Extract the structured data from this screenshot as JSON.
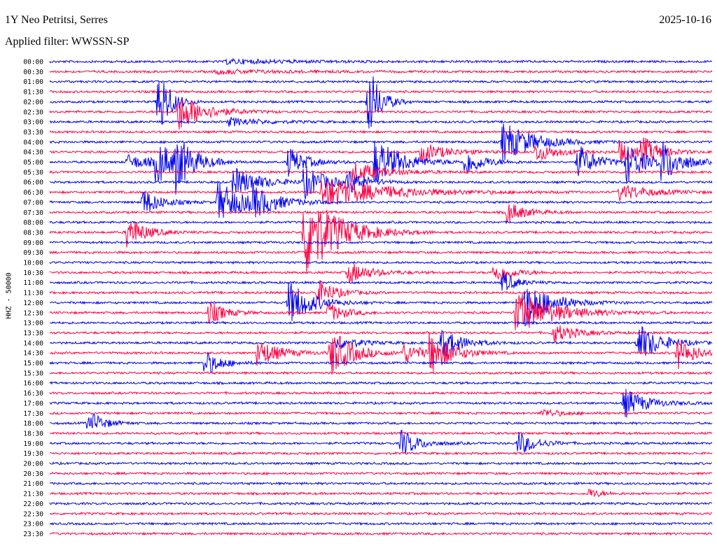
{
  "header": {
    "station": "1Y Neo Petritsi, Serres",
    "date": "2025-10-16",
    "filter": "Applied filter: WWSSN-SP"
  },
  "colors": {
    "even_trace": "#0000ee",
    "odd_trace": "#ff0044",
    "text": "#000000"
  },
  "chart_data": {
    "type": "line",
    "title": "1Y Neo Petritsi, Serres",
    "ylabel": "HHZ - 50000",
    "rows": [
      "00:00",
      "00:30",
      "01:00",
      "01:30",
      "02:00",
      "02:30",
      "03:00",
      "03:30",
      "04:00",
      "04:30",
      "05:00",
      "05:30",
      "06:00",
      "06:30",
      "07:00",
      "07:30",
      "08:00",
      "08:30",
      "09:00",
      "09:30",
      "10:00",
      "10:30",
      "11:00",
      "11:30",
      "12:00",
      "12:30",
      "13:00",
      "13:30",
      "14:00",
      "14:30",
      "15:00",
      "15:30",
      "16:00",
      "16:30",
      "17:00",
      "17:30",
      "18:00",
      "18:30",
      "19:00",
      "19:30",
      "20:00",
      "20:30",
      "21:00",
      "21:30",
      "22:00",
      "22:30",
      "23:00",
      "23:30"
    ],
    "minutes_per_row": 30,
    "events": [
      {
        "row": 4,
        "minute": 4.9,
        "amp": 60,
        "dur": 0.5
      },
      {
        "row": 5,
        "minute": 5.8,
        "amp": 28,
        "dur": 1.2
      },
      {
        "row": 4,
        "minute": 14.4,
        "amp": 60,
        "dur": 0.5
      },
      {
        "row": 8,
        "minute": 20.5,
        "amp": 30,
        "dur": 1.4
      },
      {
        "row": 13,
        "minute": 12.3,
        "amp": 22,
        "dur": 3.0
      },
      {
        "row": 10,
        "minute": 4.8,
        "amp": 32,
        "dur": 0.8
      },
      {
        "row": 10,
        "minute": 5.7,
        "amp": 34,
        "dur": 0.8
      },
      {
        "row": 10,
        "minute": 10.8,
        "amp": 22,
        "dur": 0.8
      },
      {
        "row": 10,
        "minute": 14.7,
        "amp": 36,
        "dur": 1.2
      },
      {
        "row": 10,
        "minute": 18.8,
        "amp": 20,
        "dur": 0.8
      },
      {
        "row": 10,
        "minute": 23.9,
        "amp": 26,
        "dur": 0.8
      },
      {
        "row": 10,
        "minute": 26.1,
        "amp": 30,
        "dur": 0.8
      },
      {
        "row": 10,
        "minute": 27.7,
        "amp": 30,
        "dur": 0.9
      },
      {
        "row": 9,
        "minute": 16.8,
        "amp": 14,
        "dur": 1.2
      },
      {
        "row": 9,
        "minute": 22.0,
        "amp": 14,
        "dur": 1.0
      },
      {
        "row": 9,
        "minute": 25.8,
        "amp": 16,
        "dur": 0.8
      },
      {
        "row": 9,
        "minute": 26.8,
        "amp": 20,
        "dur": 0.8
      },
      {
        "row": 8,
        "minute": 32.0,
        "amp": 22,
        "dur": 0.6
      },
      {
        "row": 10,
        "minute": 3.5,
        "amp": 10,
        "dur": 1.5
      },
      {
        "row": 12,
        "minute": 8.3,
        "amp": 22,
        "dur": 1.2
      },
      {
        "row": 12,
        "minute": 13.5,
        "amp": 16,
        "dur": 0.8
      },
      {
        "row": 11,
        "minute": 13.7,
        "amp": 14,
        "dur": 1.5
      },
      {
        "row": 14,
        "minute": 4.2,
        "amp": 20,
        "dur": 0.8
      },
      {
        "row": 14,
        "minute": 7.6,
        "amp": 30,
        "dur": 1.3
      },
      {
        "row": 14,
        "minute": 9.1,
        "amp": 20,
        "dur": 1.0
      },
      {
        "row": 15,
        "minute": 20.7,
        "amp": 16,
        "dur": 0.8
      },
      {
        "row": 13,
        "minute": 25.8,
        "amp": 12,
        "dur": 1.4
      },
      {
        "row": 17,
        "minute": 3.5,
        "amp": 24,
        "dur": 0.8
      },
      {
        "row": 17,
        "minute": 11.5,
        "amp": 70,
        "dur": 1.5
      },
      {
        "row": 12,
        "minute": 11.5,
        "amp": 24,
        "dur": 1.0
      },
      {
        "row": 21,
        "minute": 13.5,
        "amp": 16,
        "dur": 1.0
      },
      {
        "row": 21,
        "minute": 20.1,
        "amp": 14,
        "dur": 0.9
      },
      {
        "row": 24,
        "minute": 10.8,
        "amp": 34,
        "dur": 1.0
      },
      {
        "row": 23,
        "minute": 12.1,
        "amp": 20,
        "dur": 0.8
      },
      {
        "row": 24,
        "minute": 21.5,
        "amp": 34,
        "dur": 1.2
      },
      {
        "row": 25,
        "minute": 21.1,
        "amp": 32,
        "dur": 1.8
      },
      {
        "row": 22,
        "minute": 20.5,
        "amp": 16,
        "dur": 0.6
      },
      {
        "row": 25,
        "minute": 7.2,
        "amp": 18,
        "dur": 0.7
      },
      {
        "row": 25,
        "minute": 12.6,
        "amp": 14,
        "dur": 0.8
      },
      {
        "row": 27,
        "minute": 22.8,
        "amp": 14,
        "dur": 1.0
      },
      {
        "row": 28,
        "minute": 13.0,
        "amp": 10,
        "dur": 1.0
      },
      {
        "row": 28,
        "minute": 17.7,
        "amp": 24,
        "dur": 0.9
      },
      {
        "row": 28,
        "minute": 26.6,
        "amp": 30,
        "dur": 1.0
      },
      {
        "row": 29,
        "minute": 9.4,
        "amp": 20,
        "dur": 1.0
      },
      {
        "row": 29,
        "minute": 12.7,
        "amp": 36,
        "dur": 1.0
      },
      {
        "row": 29,
        "minute": 16.0,
        "amp": 14,
        "dur": 1.0
      },
      {
        "row": 29,
        "minute": 17.2,
        "amp": 28,
        "dur": 1.0
      },
      {
        "row": 29,
        "minute": 28.4,
        "amp": 24,
        "dur": 0.8
      },
      {
        "row": 30,
        "minute": 7.0,
        "amp": 20,
        "dur": 0.7
      },
      {
        "row": 34,
        "minute": 26.0,
        "amp": 22,
        "dur": 1.0
      },
      {
        "row": 35,
        "minute": 22.3,
        "amp": 6,
        "dur": 1.0
      },
      {
        "row": 36,
        "minute": 1.7,
        "amp": 10,
        "dur": 0.6
      },
      {
        "row": 36,
        "minute": 2.0,
        "amp": 8,
        "dur": 0.6
      },
      {
        "row": 38,
        "minute": 15.9,
        "amp": 20,
        "dur": 0.8
      },
      {
        "row": 38,
        "minute": 21.2,
        "amp": 18,
        "dur": 0.8
      },
      {
        "row": 43,
        "minute": 24.4,
        "amp": 7,
        "dur": 0.6
      },
      {
        "row": 6,
        "minute": 8.1,
        "amp": 6,
        "dur": 1.5
      },
      {
        "row": 1,
        "minute": 7.5,
        "amp": 3,
        "dur": 3.0
      },
      {
        "row": 0,
        "minute": 8.0,
        "amp": 3,
        "dur": 3.5
      }
    ]
  }
}
